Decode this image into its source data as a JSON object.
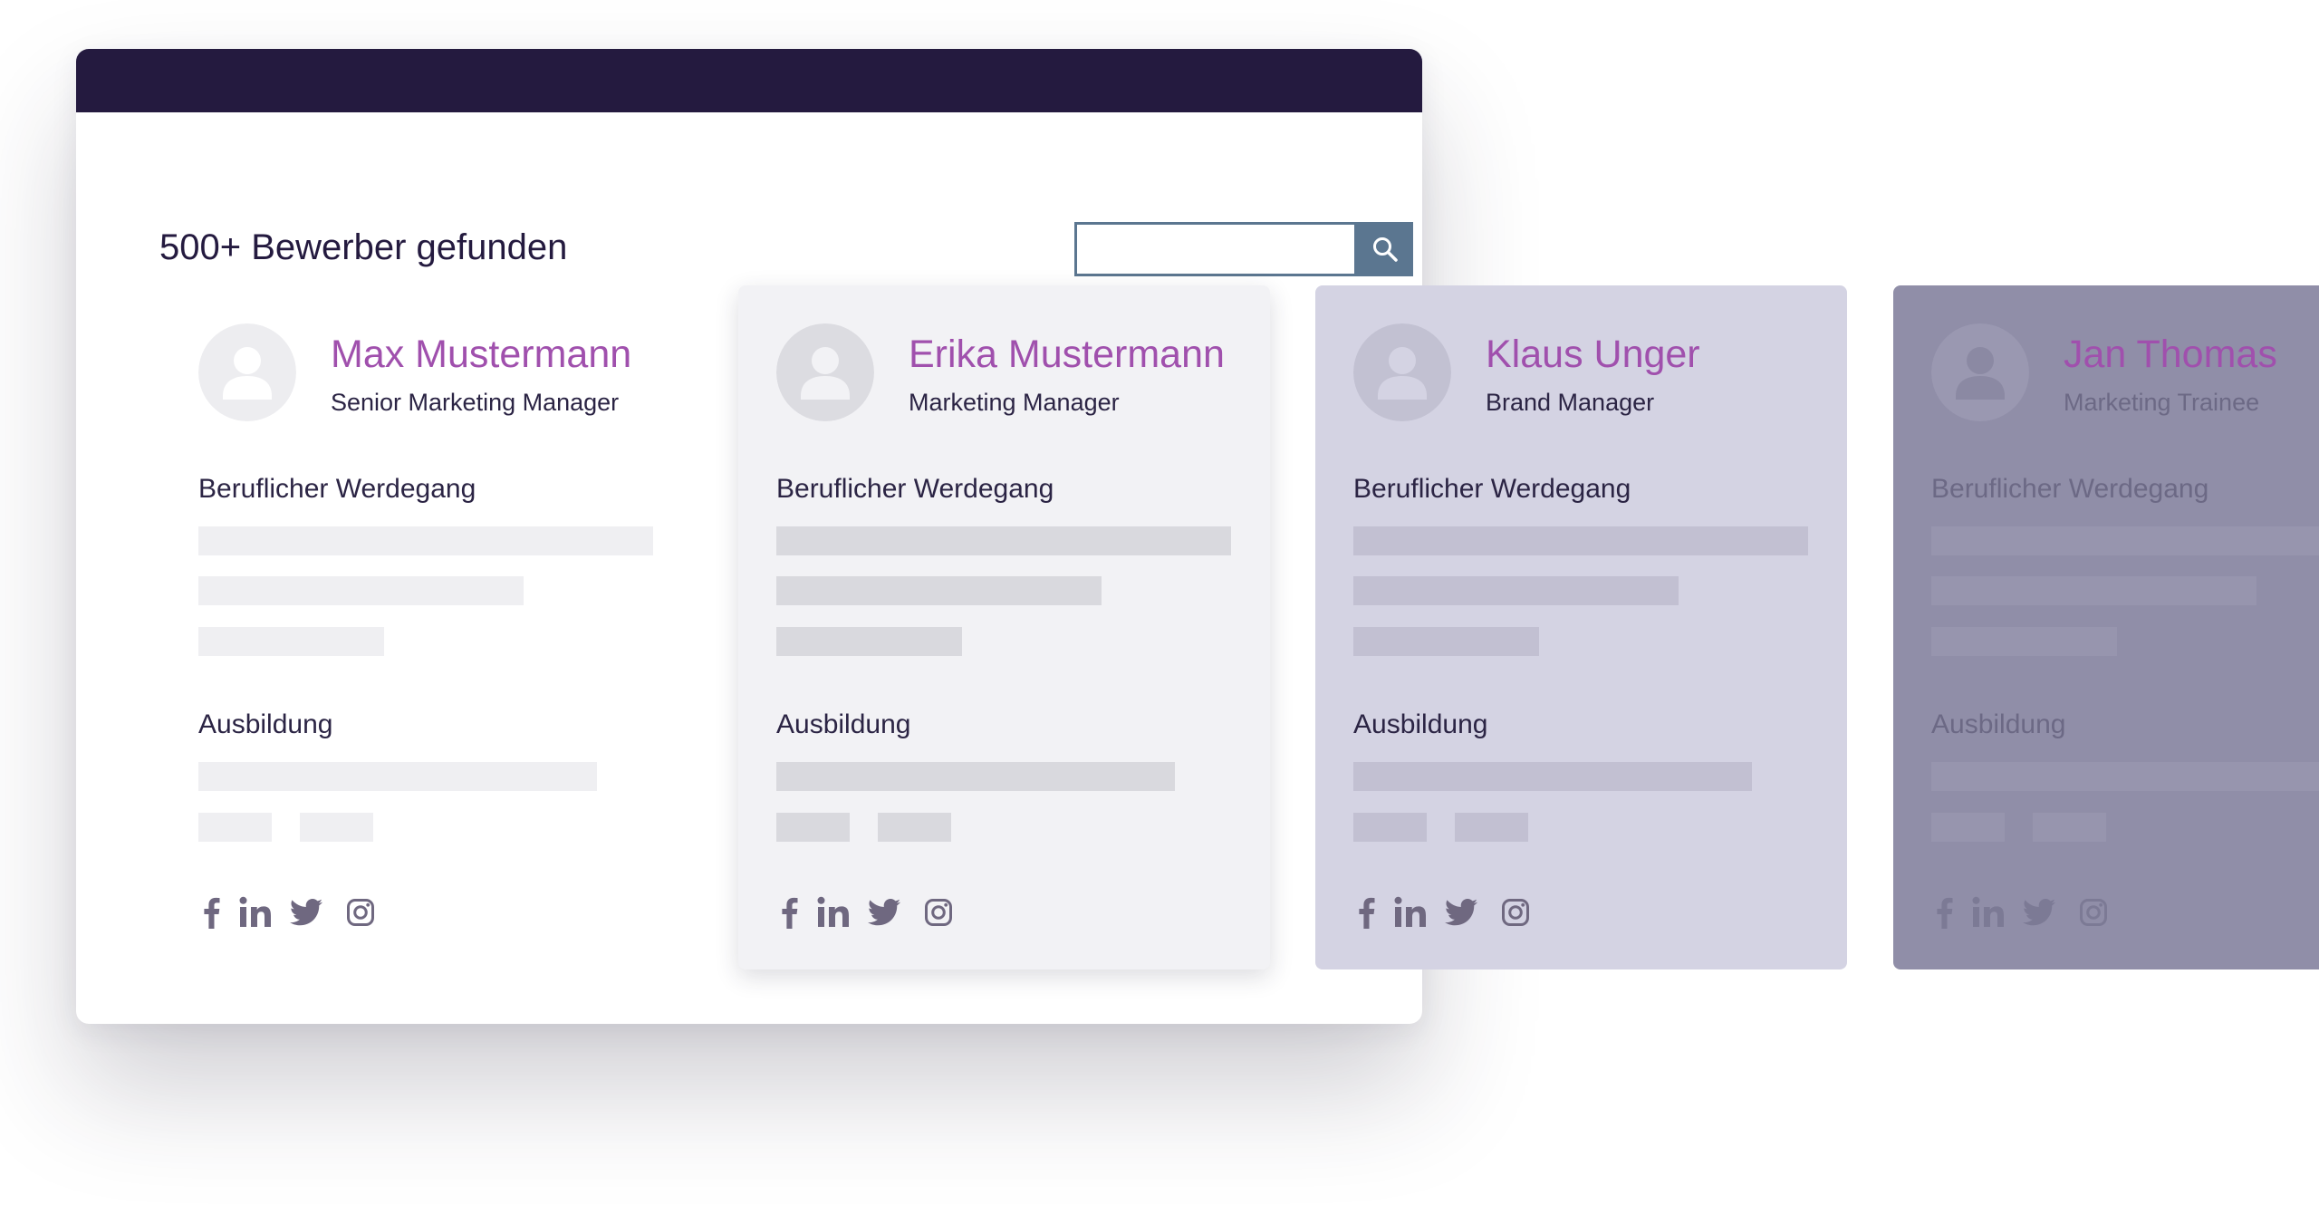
{
  "colors": {
    "window_bar": "#241a3f",
    "search_accent": "#5b7690",
    "name_accent": "#a050ad",
    "text_dark": "#2b2444"
  },
  "header": {
    "results_title": "500+ Bewerber gefunden"
  },
  "search": {
    "value": "",
    "icon": "search-icon"
  },
  "cards": [
    {
      "name": "Max Mustermann",
      "role": "Senior Marketing Manager",
      "career_label": "Beruflicher Werdegang",
      "education_label": "Ausbildung",
      "style": {
        "name_color": "#a050ad",
        "text_color": "#2b2444",
        "placeholder_color": "#efeff2",
        "avatar_bg": "#ededf0",
        "avatar_fg": "#ffffff",
        "icon_color": "#6f6880"
      }
    },
    {
      "name": "Erika Mustermann",
      "role": "Marketing Manager",
      "career_label": "Beruflicher Werdegang",
      "education_label": "Ausbildung",
      "style": {
        "name_color": "#a050ad",
        "text_color": "#2b2444",
        "placeholder_color": "#d9d9de",
        "avatar_bg": "#dcdce1",
        "avatar_fg": "#f2f2f5",
        "icon_color": "#6f6880"
      }
    },
    {
      "name": "Klaus Unger",
      "role": "Brand Manager",
      "career_label": "Beruflicher Werdegang",
      "education_label": "Ausbildung",
      "style": {
        "name_color": "#a050ad",
        "text_color": "#2b2444",
        "placeholder_color": "#c2c0d2",
        "avatar_bg": "#c2c1d2",
        "avatar_fg": "#d4d3e3",
        "icon_color": "#6f6880"
      }
    },
    {
      "name": "Jan Thomas",
      "role": "Marketing Trainee",
      "career_label": "Beruflicher Werdegang",
      "education_label": "Ausbildung",
      "style": {
        "name_color": "#a050ad",
        "text_color": "#6c6985",
        "placeholder_color": "#9795ae",
        "avatar_bg": "#9a98b1",
        "avatar_fg": "#8b89a3",
        "icon_color": "#7c7a95"
      }
    }
  ],
  "social_icons": [
    "facebook-icon",
    "linkedin-icon",
    "twitter-icon",
    "instagram-icon"
  ]
}
